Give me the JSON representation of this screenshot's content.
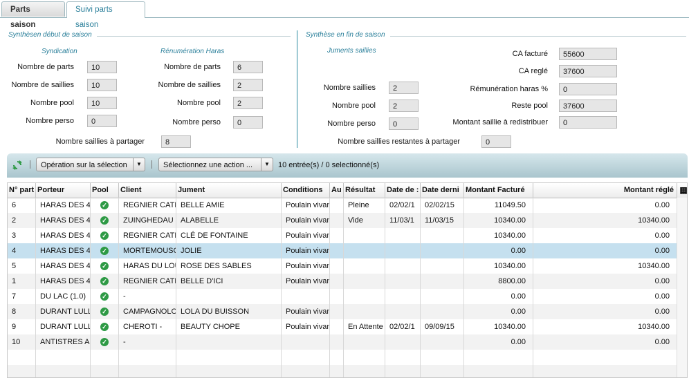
{
  "tabs": [
    "Parts saison",
    "Suivi parts saison"
  ],
  "debut": {
    "title": "Synthèsen début de saison",
    "syndication": {
      "title": "Syndication",
      "fields": [
        {
          "label": "Nombre de parts",
          "value": "10"
        },
        {
          "label": "Nombre de saillies",
          "value": "10"
        },
        {
          "label": "Nombre pool",
          "value": "10"
        },
        {
          "label": "Nombre perso",
          "value": "0"
        }
      ]
    },
    "remuneration": {
      "title": "Rénumération Haras",
      "fields": [
        {
          "label": "Nombre de parts",
          "value": "6"
        },
        {
          "label": "Nombre de saillies",
          "value": "2"
        },
        {
          "label": "Nombre pool",
          "value": "2"
        },
        {
          "label": "Nombre perso",
          "value": "0"
        }
      ]
    },
    "partager": {
      "label": "Nombre saillies à partager",
      "value": "8"
    }
  },
  "fin": {
    "title": "Synthèse en fin de saison",
    "juments": {
      "title": "Juments saillies",
      "fields": [
        {
          "label": "Nombre saillies",
          "value": "2"
        },
        {
          "label": "Nombre pool",
          "value": "2"
        },
        {
          "label": "Nombre perso",
          "value": "0"
        }
      ]
    },
    "ca": [
      {
        "label": "CA facturé",
        "value": "55600"
      },
      {
        "label": "CA reglé",
        "value": "37600"
      },
      {
        "label": "Rémunération haras %",
        "value": "0"
      },
      {
        "label": "Reste pool",
        "value": "37600"
      },
      {
        "label": "Montant saillie à redistribuer",
        "value": "0"
      }
    ],
    "restantes": {
      "label": "Nombre saillies restantes à partager",
      "value": "0"
    }
  },
  "toolbar": {
    "operation": "Opération sur la sélection",
    "action": "Sélectionnez une action ...",
    "count": "10 entrée(s) / 0 selectionné(s)"
  },
  "grid": {
    "headers": [
      "N° part",
      "Porteur",
      "Pool",
      "Client",
      "Jument",
      "Conditions",
      "Au",
      "Résultat",
      "Date de :",
      "Date derni",
      "Montant Facturé",
      "Montant réglé"
    ],
    "rows": [
      [
        "6",
        "HARAS DES 4",
        true,
        "REGNIER CATH",
        "BELLE AMIE",
        "Poulain vivant",
        "",
        "Pleine",
        "02/02/1",
        "02/02/15",
        "11049.50",
        "0.00"
      ],
      [
        "2",
        "HARAS DES 4",
        true,
        "ZUINGHEDAU J.",
        "ALABELLE",
        "Poulain vivant",
        "",
        "Vide",
        "11/03/1",
        "11/03/15",
        "10340.00",
        "10340.00"
      ],
      [
        "3",
        "HARAS DES 4",
        true,
        "REGNIER CATH",
        "CLÉ DE FONTAINE",
        "Poulain vivant",
        "",
        "",
        "",
        "",
        "10340.00",
        "0.00"
      ],
      [
        "4",
        "HARAS DES 4",
        true,
        "MORTEMOUSQU",
        "JOLIE",
        "Poulain vivant",
        "",
        "",
        "",
        "",
        "0.00",
        "0.00"
      ],
      [
        "5",
        "HARAS DES 4",
        true,
        "HARAS DU LOU",
        "ROSE DES SABLES",
        "Poulain vivant",
        "",
        "",
        "",
        "",
        "10340.00",
        "10340.00"
      ],
      [
        "1",
        "HARAS DES 4",
        true,
        "REGNIER CATH",
        "BELLE D'ICI",
        "Poulain vivant",
        "",
        "",
        "",
        "",
        "8800.00",
        "0.00"
      ],
      [
        "7",
        "DU LAC (1.0)",
        true,
        "-",
        "",
        "",
        "",
        "",
        "",
        "",
        "0.00",
        "0.00"
      ],
      [
        "8",
        "DURANT LULL",
        true,
        "CAMPAGNOLO",
        "LOLA DU BUISSON",
        "Poulain vivant",
        "",
        "",
        "",
        "",
        "0.00",
        "0.00"
      ],
      [
        "9",
        "DURANT LULL",
        true,
        "CHEROTI  -",
        "BEAUTY CHOPE",
        "Poulain vivant",
        "",
        "En Attente",
        "02/02/1",
        "09/09/15",
        "10340.00",
        "10340.00"
      ],
      [
        "10",
        "ANTISTRES A",
        true,
        "-",
        "",
        "",
        "",
        "",
        "",
        "",
        "0.00",
        "0.00"
      ]
    ],
    "selected_row": 3
  }
}
